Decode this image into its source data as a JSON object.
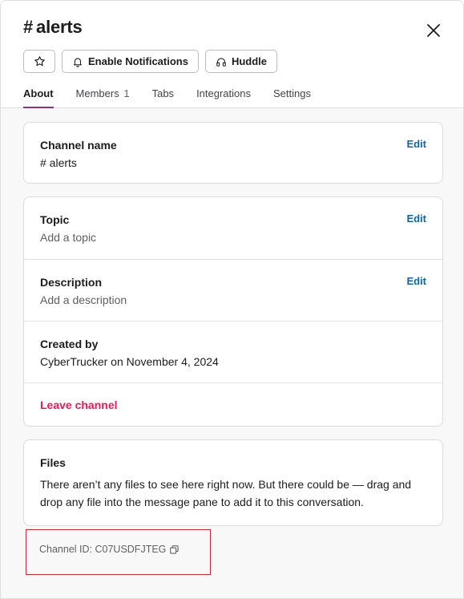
{
  "header": {
    "hash_symbol": "#",
    "channel_title": "alerts",
    "close_icon": "close-icon",
    "star_icon": "star-icon",
    "enable_notifications_label": "Enable Notifications",
    "bell_icon": "bell-icon",
    "huddle_label": "Huddle",
    "headphones_icon": "headphones-icon"
  },
  "tabs": {
    "about": "About",
    "members": "Members",
    "members_count": "1",
    "tabs": "Tabs",
    "integrations": "Integrations",
    "settings": "Settings",
    "active_color": "#7c3a83"
  },
  "channel_name": {
    "label": "Channel name",
    "value": "# alerts",
    "edit": "Edit"
  },
  "topic": {
    "label": "Topic",
    "placeholder": "Add a topic",
    "edit": "Edit"
  },
  "description": {
    "label": "Description",
    "placeholder": "Add a description",
    "edit": "Edit"
  },
  "created_by": {
    "label": "Created by",
    "value": "CyberTrucker on November 4, 2024"
  },
  "leave_channel": "Leave channel",
  "files": {
    "label": "Files",
    "text": "There aren’t any files to see here right now. But there could be — drag and drop any file into the message pane to add it to this conversation."
  },
  "footer": {
    "channel_id": "Channel ID: C07USDFJTEG",
    "copy_icon": "copy-icon"
  },
  "colors": {
    "link": "#1264a3",
    "danger": "#e01e5a",
    "highlight_box": "#c0303a"
  }
}
